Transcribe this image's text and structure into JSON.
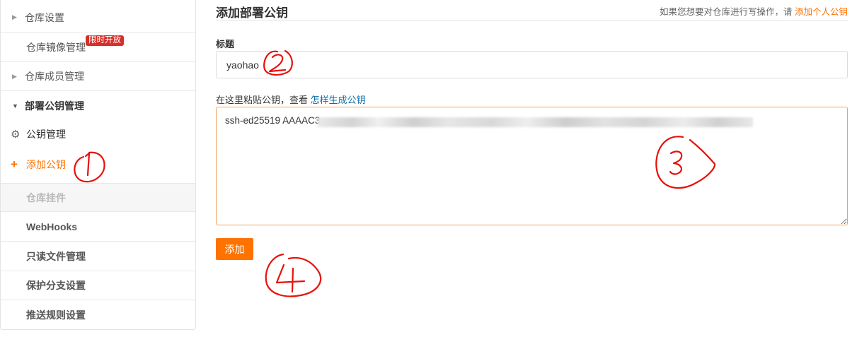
{
  "sidebar": {
    "items": [
      {
        "label": "仓库设置"
      },
      {
        "label": "仓库镜像管理",
        "badge": "限时开放"
      },
      {
        "label": "仓库成员管理"
      },
      {
        "label": "部署公钥管理"
      },
      {
        "label": "公钥管理",
        "icon": "gear-icon"
      },
      {
        "label": "添加公钥",
        "icon": "plus-icon"
      },
      {
        "label": "仓库挂件"
      },
      {
        "label": "WebHooks"
      },
      {
        "label": "只读文件管理"
      },
      {
        "label": "保护分支设置"
      },
      {
        "label": "推送规则设置"
      }
    ]
  },
  "main": {
    "title": "添加部署公钥",
    "hint_text": "如果您想要对仓库进行写操作，请",
    "hint_link": "添加个人公钥",
    "title_label": "标题",
    "title_value": "yaohao",
    "key_label": "在这里粘贴公钥，查看",
    "key_help_link": "怎样生成公钥",
    "key_value": "ssh-ed25519 AAAAC3",
    "submit_label": "添加"
  },
  "colors": {
    "accent": "#fe7300",
    "link": "#0b6ea8",
    "annotation": "#e8100a",
    "badge": "#d3302b"
  }
}
